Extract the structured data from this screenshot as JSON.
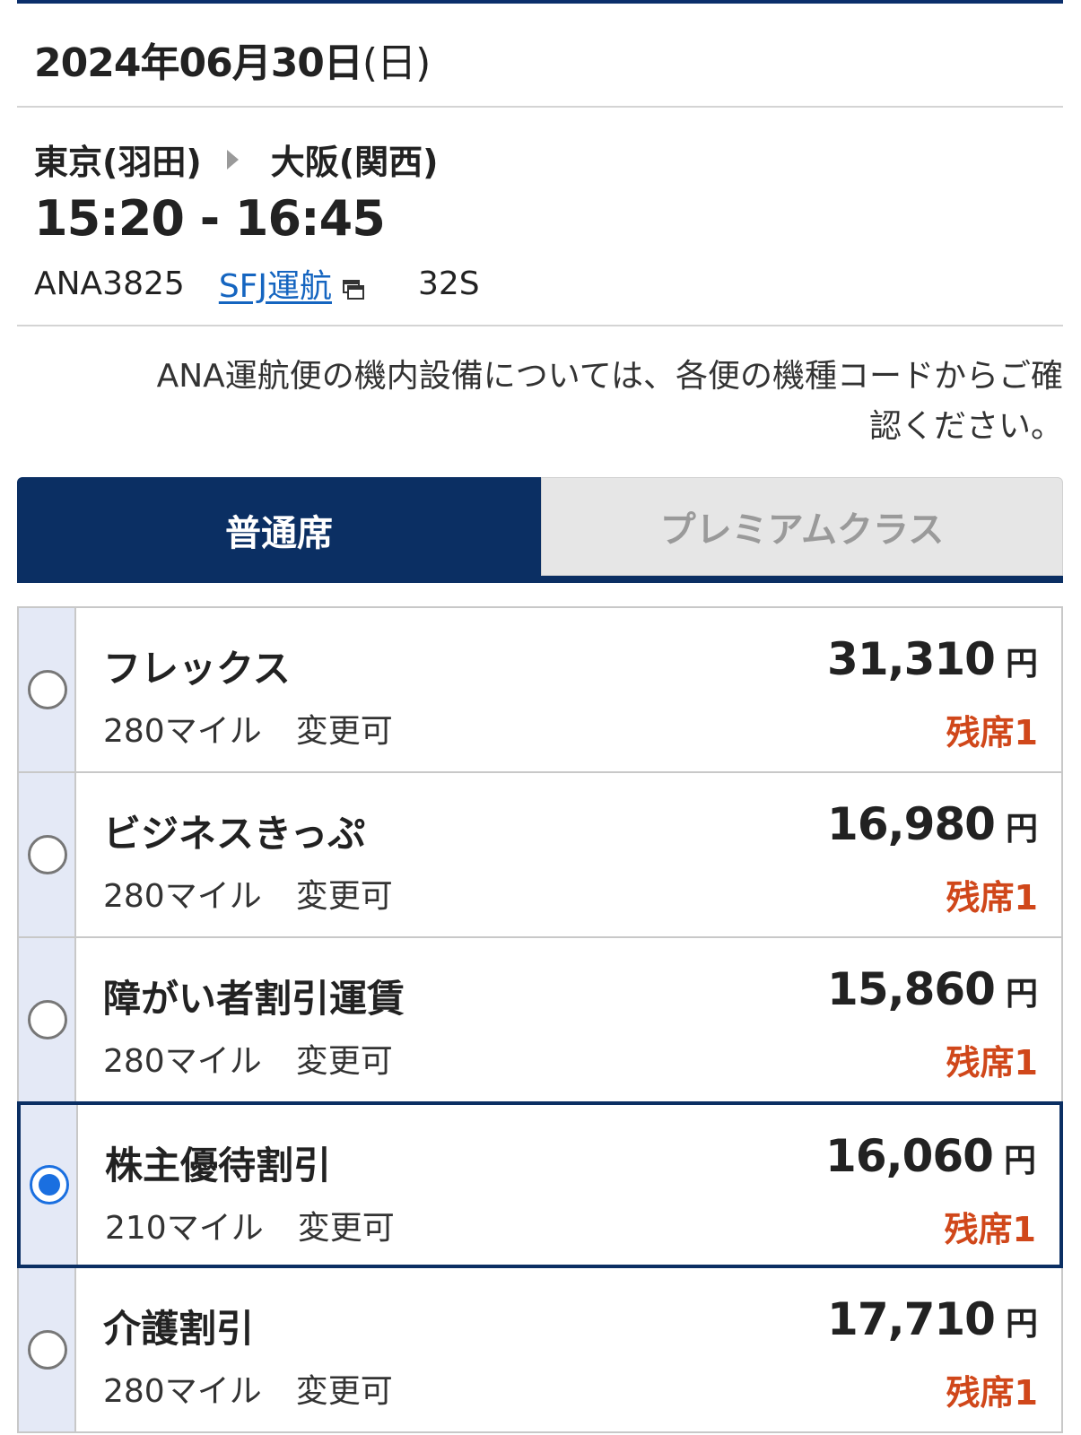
{
  "header": {
    "date": "2024年06月30日",
    "day_of_week": "(日)"
  },
  "flight": {
    "origin": "東京(羽田)",
    "destination": "大阪(関西)",
    "time_range": "15:20 - 16:45",
    "flight_number": "ANA3825",
    "operator": "SFJ運航",
    "aircraft_code": "32S"
  },
  "notice": {
    "line1": "ANA運航便の機内設備については、各便の機種コードからご確",
    "line2": "認ください。"
  },
  "tabs": [
    {
      "label": "普通席",
      "active": true
    },
    {
      "label": "プレミアムクラス",
      "active": false
    }
  ],
  "fares": [
    {
      "name": "フレックス",
      "miles": "280マイル",
      "change": "変更可",
      "price": "31,310",
      "currency": "円",
      "seats": "残席1",
      "selected": false
    },
    {
      "name": "ビジネスきっぷ",
      "miles": "280マイル",
      "change": "変更可",
      "price": "16,980",
      "currency": "円",
      "seats": "残席1",
      "selected": false
    },
    {
      "name": "障がい者割引運賃",
      "miles": "280マイル",
      "change": "変更可",
      "price": "15,860",
      "currency": "円",
      "seats": "残席1",
      "selected": false
    },
    {
      "name": "株主優待割引",
      "miles": "210マイル",
      "change": "変更可",
      "price": "16,060",
      "currency": "円",
      "seats": "残席1",
      "selected": true
    },
    {
      "name": "介護割引",
      "miles": "280マイル",
      "change": "変更可",
      "price": "17,710",
      "currency": "円",
      "seats": "残席1",
      "selected": false
    }
  ],
  "colors": {
    "brand_navy": "#0b2f63",
    "link_blue": "#1565c0",
    "seats_orange": "#d0471a",
    "radio_blue": "#1a6fe0"
  },
  "icons": {
    "external_link": "external-window-icon",
    "route_arrow": "triangle-right-icon"
  }
}
